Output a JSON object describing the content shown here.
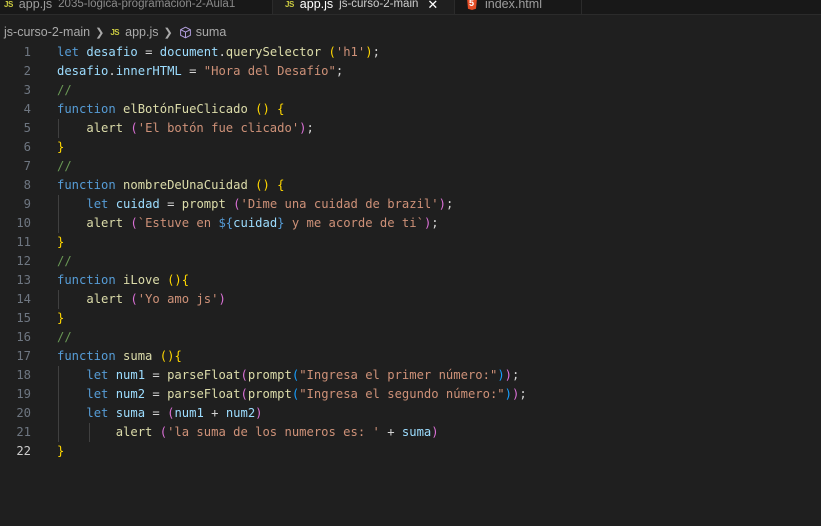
{
  "tabs": [
    {
      "file": "app.js",
      "description": "2035-logica-programacion-2-Aula1",
      "active": false,
      "icon": "js-icon"
    },
    {
      "file": "app.js",
      "description": "js-curso-2-main",
      "active": true,
      "icon": "js-icon"
    },
    {
      "file": "index.html",
      "description": "",
      "active": false,
      "icon": "html5-icon"
    }
  ],
  "js_icon_text": "JS",
  "breadcrumb": {
    "folder": "js-curso-2-main",
    "file": "app.js",
    "symbol": "suma"
  },
  "editor": {
    "current_line": 22,
    "lines": [
      {
        "n": "1",
        "indent": 0,
        "tokens": [
          [
            "kw",
            "let"
          ],
          [
            "pl",
            " "
          ],
          [
            "var",
            "desafio"
          ],
          [
            "pl",
            " = "
          ],
          [
            "var",
            "document"
          ],
          [
            "pl",
            "."
          ],
          [
            "fn",
            "querySelector"
          ],
          [
            "pl",
            " "
          ],
          [
            "br1",
            "("
          ],
          [
            "str",
            "'h1'"
          ],
          [
            "br1",
            ")"
          ],
          [
            "pl",
            ";"
          ]
        ]
      },
      {
        "n": "2",
        "indent": 0,
        "tokens": [
          [
            "var",
            "desafio"
          ],
          [
            "pl",
            "."
          ],
          [
            "var",
            "innerHTML"
          ],
          [
            "pl",
            " = "
          ],
          [
            "str",
            "\"Hora del Desafío\""
          ],
          [
            "pl",
            ";"
          ]
        ]
      },
      {
        "n": "3",
        "indent": 0,
        "tokens": [
          [
            "cmt",
            "//"
          ]
        ]
      },
      {
        "n": "4",
        "indent": 0,
        "tokens": [
          [
            "kw",
            "function"
          ],
          [
            "pl",
            " "
          ],
          [
            "fn",
            "elBotónFueClicado"
          ],
          [
            "pl",
            " "
          ],
          [
            "br1",
            "()"
          ],
          [
            "pl",
            " "
          ],
          [
            "br1",
            "{"
          ]
        ]
      },
      {
        "n": "5",
        "indent": 1,
        "tokens": [
          [
            "fn",
            "alert"
          ],
          [
            "pl",
            " "
          ],
          [
            "br2",
            "("
          ],
          [
            "str",
            "'El botón fue clicado'"
          ],
          [
            "br2",
            ")"
          ],
          [
            "pl",
            ";"
          ]
        ]
      },
      {
        "n": "6",
        "indent": 0,
        "tokens": [
          [
            "br1",
            "}"
          ]
        ]
      },
      {
        "n": "7",
        "indent": 0,
        "tokens": [
          [
            "cmt",
            "//"
          ]
        ]
      },
      {
        "n": "8",
        "indent": 0,
        "tokens": [
          [
            "kw",
            "function"
          ],
          [
            "pl",
            " "
          ],
          [
            "fn",
            "nombreDeUnaCuidad"
          ],
          [
            "pl",
            " "
          ],
          [
            "br1",
            "()"
          ],
          [
            "pl",
            " "
          ],
          [
            "br1",
            "{"
          ]
        ]
      },
      {
        "n": "9",
        "indent": 1,
        "tokens": [
          [
            "kw",
            "let"
          ],
          [
            "pl",
            " "
          ],
          [
            "var",
            "cuidad"
          ],
          [
            "pl",
            " = "
          ],
          [
            "fn",
            "prompt"
          ],
          [
            "pl",
            " "
          ],
          [
            "br2",
            "("
          ],
          [
            "str",
            "'Dime una cuidad de brazil'"
          ],
          [
            "br2",
            ")"
          ],
          [
            "pl",
            ";"
          ]
        ]
      },
      {
        "n": "10",
        "indent": 1,
        "tokens": [
          [
            "fn",
            "alert"
          ],
          [
            "pl",
            " "
          ],
          [
            "br2",
            "("
          ],
          [
            "str",
            "`Estuve en "
          ],
          [
            "kw",
            "${"
          ],
          [
            "var",
            "cuidad"
          ],
          [
            "kw",
            "}"
          ],
          [
            "str",
            " y me acorde de ti`"
          ],
          [
            "br2",
            ")"
          ],
          [
            "pl",
            ";"
          ]
        ]
      },
      {
        "n": "11",
        "indent": 0,
        "tokens": [
          [
            "br1",
            "}"
          ]
        ]
      },
      {
        "n": "12",
        "indent": 0,
        "tokens": [
          [
            "cmt",
            "//"
          ]
        ]
      },
      {
        "n": "13",
        "indent": 0,
        "tokens": [
          [
            "kw",
            "function"
          ],
          [
            "pl",
            " "
          ],
          [
            "fn",
            "iLove"
          ],
          [
            "pl",
            " "
          ],
          [
            "br1",
            "()"
          ],
          [
            "br1",
            "{"
          ]
        ]
      },
      {
        "n": "14",
        "indent": 1,
        "tokens": [
          [
            "fn",
            "alert"
          ],
          [
            "pl",
            " "
          ],
          [
            "br2",
            "("
          ],
          [
            "str",
            "'Yo amo js'"
          ],
          [
            "br2",
            ")"
          ]
        ]
      },
      {
        "n": "15",
        "indent": 0,
        "tokens": [
          [
            "br1",
            "}"
          ]
        ]
      },
      {
        "n": "16",
        "indent": 0,
        "tokens": [
          [
            "cmt",
            "//"
          ]
        ]
      },
      {
        "n": "17",
        "indent": 0,
        "tokens": [
          [
            "kw",
            "function"
          ],
          [
            "pl",
            " "
          ],
          [
            "fn",
            "suma"
          ],
          [
            "pl",
            " "
          ],
          [
            "br1",
            "()"
          ],
          [
            "br1",
            "{"
          ]
        ]
      },
      {
        "n": "18",
        "indent": 1,
        "tokens": [
          [
            "kw",
            "let"
          ],
          [
            "pl",
            " "
          ],
          [
            "var",
            "num1"
          ],
          [
            "pl",
            " = "
          ],
          [
            "fn",
            "parseFloat"
          ],
          [
            "br2",
            "("
          ],
          [
            "fn",
            "prompt"
          ],
          [
            "br3",
            "("
          ],
          [
            "str",
            "\"Ingresa el primer número:\""
          ],
          [
            "br3",
            ")"
          ],
          [
            "br2",
            ")"
          ],
          [
            "pl",
            ";"
          ]
        ]
      },
      {
        "n": "19",
        "indent": 1,
        "tokens": [
          [
            "kw",
            "let"
          ],
          [
            "pl",
            " "
          ],
          [
            "var",
            "num2"
          ],
          [
            "pl",
            " = "
          ],
          [
            "fn",
            "parseFloat"
          ],
          [
            "br2",
            "("
          ],
          [
            "fn",
            "prompt"
          ],
          [
            "br3",
            "("
          ],
          [
            "str",
            "\"Ingresa el segundo número:\""
          ],
          [
            "br3",
            ")"
          ],
          [
            "br2",
            ")"
          ],
          [
            "pl",
            ";"
          ]
        ]
      },
      {
        "n": "20",
        "indent": 1,
        "tokens": [
          [
            "kw",
            "let"
          ],
          [
            "pl",
            " "
          ],
          [
            "var",
            "suma"
          ],
          [
            "pl",
            " = "
          ],
          [
            "br2",
            "("
          ],
          [
            "var",
            "num1"
          ],
          [
            "pl",
            " + "
          ],
          [
            "var",
            "num2"
          ],
          [
            "br2",
            ")"
          ]
        ]
      },
      {
        "n": "21",
        "indent": 2,
        "tokens": [
          [
            "fn",
            "alert"
          ],
          [
            "pl",
            " "
          ],
          [
            "br2",
            "("
          ],
          [
            "str",
            "'la suma de los numeros es: '"
          ],
          [
            "pl",
            " + "
          ],
          [
            "var",
            "suma"
          ],
          [
            "br2",
            ")"
          ]
        ]
      },
      {
        "n": "22",
        "indent": 0,
        "tokens": [
          [
            "br1",
            "}"
          ]
        ]
      }
    ]
  },
  "colors": {
    "keyword": "#569cd6",
    "function": "#dcdcaa",
    "variable": "#9cdcfe",
    "string": "#ce9178",
    "comment": "#6a9955",
    "bracket1": "#ffd700",
    "bracket2": "#da70d6",
    "bracket3": "#179fff",
    "background": "#1f1f1f"
  }
}
